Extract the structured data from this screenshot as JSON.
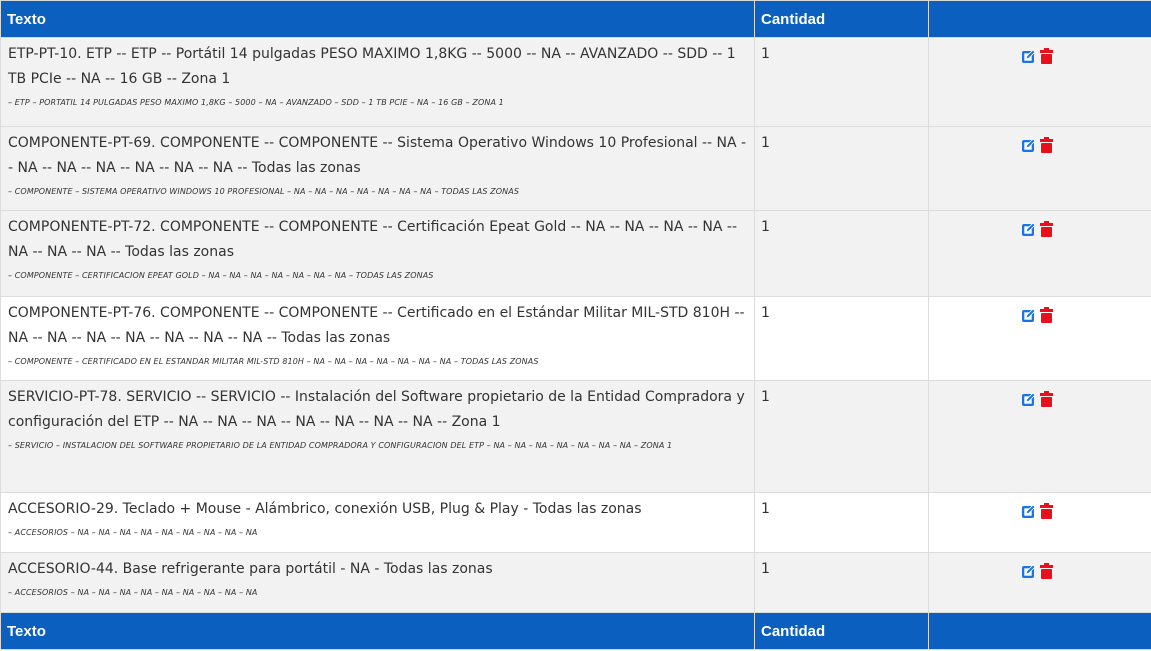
{
  "header": {
    "col_texto": "Texto",
    "col_cantidad": "Cantidad",
    "col_acciones": ""
  },
  "footer": {
    "col_texto": "Texto",
    "col_cantidad": "Cantidad",
    "col_acciones": ""
  },
  "colors": {
    "header_bg": "#0b5fbf",
    "edit_icon": "#1a73e8",
    "delete_icon": "#e8101a",
    "row_alt": "#f2f2f2"
  },
  "icons": {
    "edit": "edit-icon",
    "delete": "trash-icon"
  },
  "rows": [
    {
      "texto": "ETP-PT-10. ETP -- ETP -- Portátil 14 pulgadas PESO MAXIMO 1,8KG  -- 5000 -- NA -- AVANZADO -- SDD -- 1 TB PCIe -- NA -- 16 GB -- Zona 1",
      "detalle": "– ETP – PORTATIL 14 PULGADAS PESO MAXIMO 1,8KG – 5000 – NA – AVANZADO – SDD – 1 TB PCIE – NA – 16 GB – ZONA 1",
      "cantidad": "1"
    },
    {
      "texto": "COMPONENTE-PT-69. COMPONENTE -- COMPONENTE -- Sistema Operativo Windows 10 Profesional -- NA -- NA -- NA -- NA -- NA -- NA -- NA -- Todas las zonas",
      "detalle": "– COMPONENTE – SISTEMA OPERATIVO WINDOWS 10 PROFESIONAL – NA – NA – NA – NA – NA – NA – NA – TODAS LAS ZONAS",
      "cantidad": "1"
    },
    {
      "texto": "COMPONENTE-PT-72. COMPONENTE -- COMPONENTE -- Certificación Epeat Gold -- NA -- NA -- NA -- NA -- NA -- NA -- NA -- Todas las zonas",
      "detalle": "– COMPONENTE – CERTIFICACION EPEAT GOLD – NA – NA – NA – NA – NA – NA – NA – TODAS LAS ZONAS",
      "cantidad": "1"
    },
    {
      "texto": "COMPONENTE-PT-76. COMPONENTE -- COMPONENTE -- Certificado en el Estándar Militar MIL-STD 810H  -- NA -- NA -- NA -- NA -- NA -- NA -- NA -- Todas las zonas",
      "detalle": "– COMPONENTE – CERTIFICADO EN EL ESTANDAR MILITAR MIL-STD 810H – NA – NA – NA – NA – NA – NA – NA – TODAS LAS ZONAS",
      "cantidad": "1"
    },
    {
      "texto": "SERVICIO-PT-78. SERVICIO -- SERVICIO -- Instalación del Software propietario de la Entidad Compradora y configuración del ETP -- NA -- NA -- NA -- NA -- NA -- NA -- NA -- Zona 1",
      "detalle": "– SERVICIO – INSTALACION DEL SOFTWARE PROPIETARIO DE LA ENTIDAD COMPRADORA Y CONFIGURACION DEL ETP – NA – NA – NA – NA – NA – NA – NA – ZONA 1",
      "cantidad": "1"
    },
    {
      "texto": "ACCESORIO-29. Teclado + Mouse - Alámbrico, conexión USB, Plug & Play - Todas las zonas",
      "detalle": "– ACCESORIOS – NA – NA – NA – NA – NA – NA – NA – NA – NA",
      "cantidad": "1"
    },
    {
      "texto": "ACCESORIO-44. Base refrigerante para portátil - NA - Todas las zonas",
      "detalle": "– ACCESORIOS – NA – NA – NA – NA – NA – NA – NA – NA – NA",
      "cantidad": "1"
    }
  ]
}
